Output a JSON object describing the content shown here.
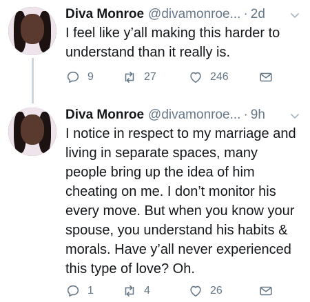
{
  "tweets": [
    {
      "name": "Diva Monroe",
      "handle": "@divamonroe...",
      "separator": "·",
      "time": "2d",
      "text": "I feel like y’all making this harder to understand than it really is.",
      "replies": "9",
      "retweets": "27",
      "likes": "246"
    },
    {
      "name": "Diva Monroe",
      "handle": "@divamonroe...",
      "separator": "·",
      "time": "9h",
      "text": "I notice in respect to my marriage and living in separate spaces, many people bring up the idea of him cheating on me. I don’t monitor his every move. But when you know your spouse, you understand his habits & morals. Have y’all never experienced this type of love? Oh.",
      "replies": "1",
      "retweets": "4",
      "likes": "26"
    }
  ],
  "icons": {
    "reply": "reply-icon",
    "retweet": "retweet-icon",
    "like": "heart-icon",
    "message": "envelope-icon",
    "more": "chevron-down-icon"
  },
  "colors": {
    "text": "#14171a",
    "muted": "#657786",
    "thread_line": "#ccd6dd"
  }
}
